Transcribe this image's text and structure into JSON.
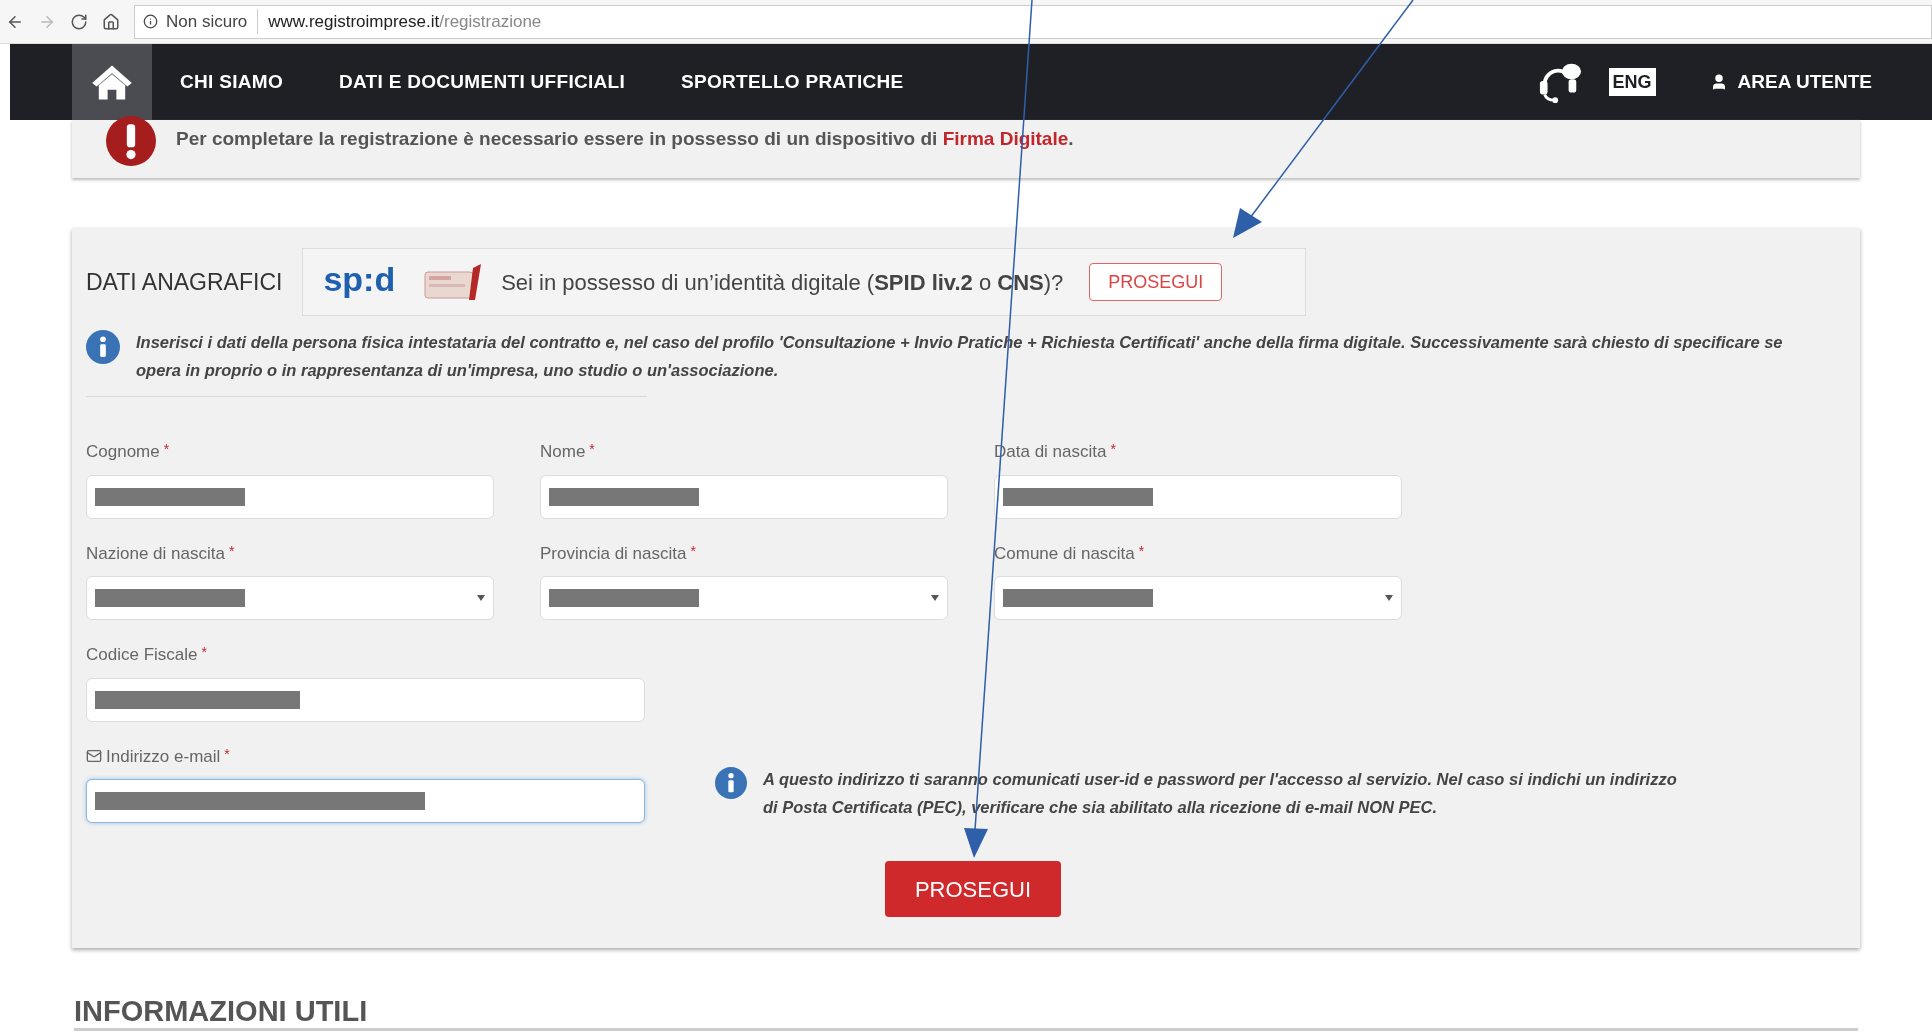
{
  "browser": {
    "security": "Non sicuro",
    "host": "www.registroimprese.it",
    "path": "/registrazione"
  },
  "nav": {
    "items": [
      {
        "label": "CHI SIAMO"
      },
      {
        "label": "DATI E DOCUMENTI UFFICIALI"
      },
      {
        "label": "SPORTELLO PRATICHE"
      }
    ],
    "lang": "ENG",
    "user": "AREA UTENTE"
  },
  "alert": {
    "text": "Per completare la registrazione è necessario essere in possesso di un dispositivo di",
    "link": "Firma Digitale",
    "end": "."
  },
  "section": {
    "title": "DATI ANAGRAFICI",
    "spid_logo": "sp:d",
    "spid_question": "Sei in possesso di un’identità digitale (**SPID liv.2** o **CNS**)?",
    "spid_button": "PROSEGUI",
    "info": "Inserisci i dati della persona fisica intestataria del contratto e, nel caso del profilo 'Consultazione + Invio Pratiche + Richiesta Certificati' anche della firma digitale. Successivamente sarà chiesto di specificare se opera in proprio o in rappresentanza di un'impresa, uno studio o un'associazione."
  },
  "field_rows": [
    [
      {
        "kind": "text",
        "label": "Cognome",
        "required_mark": "*",
        "redacted": true,
        "focused": false
      },
      {
        "kind": "text",
        "label": "Nome",
        "required_mark": "*",
        "redacted": true,
        "focused": false
      },
      {
        "kind": "text",
        "label": "Data di nascita",
        "required_mark": "*",
        "redacted": true,
        "focused": false
      }
    ],
    [
      {
        "kind": "select",
        "label": "Nazione di nascita",
        "required_mark": "*",
        "redacted": true,
        "focused": false
      },
      {
        "kind": "select",
        "label": "Provincia di nascita",
        "required_mark": "*",
        "redacted": true,
        "focused": false
      },
      {
        "kind": "select",
        "label": "Comune di nascita",
        "required_mark": "*",
        "redacted": true,
        "focused": false
      }
    ],
    [
      {
        "kind": "wide",
        "label": "Codice Fiscale",
        "required_mark": "*",
        "redacted": true,
        "focused": false
      }
    ],
    [
      {
        "kind": "email",
        "label": "Indirizzo e-mail",
        "required_mark": "*",
        "redacted": true,
        "focused": true
      }
    ]
  ],
  "email_note": "A questo indirizzo ti saranno comunicati user-id e password per l'accesso al servizio. Nel caso si indichi un indirizzo di Posta Certificata (PEC), verificare che sia abilitato alla ricezione di e-mail NON PEC.",
  "submit": "PROSEGUI",
  "footer_heading": "INFORMAZIONI UTILI"
}
